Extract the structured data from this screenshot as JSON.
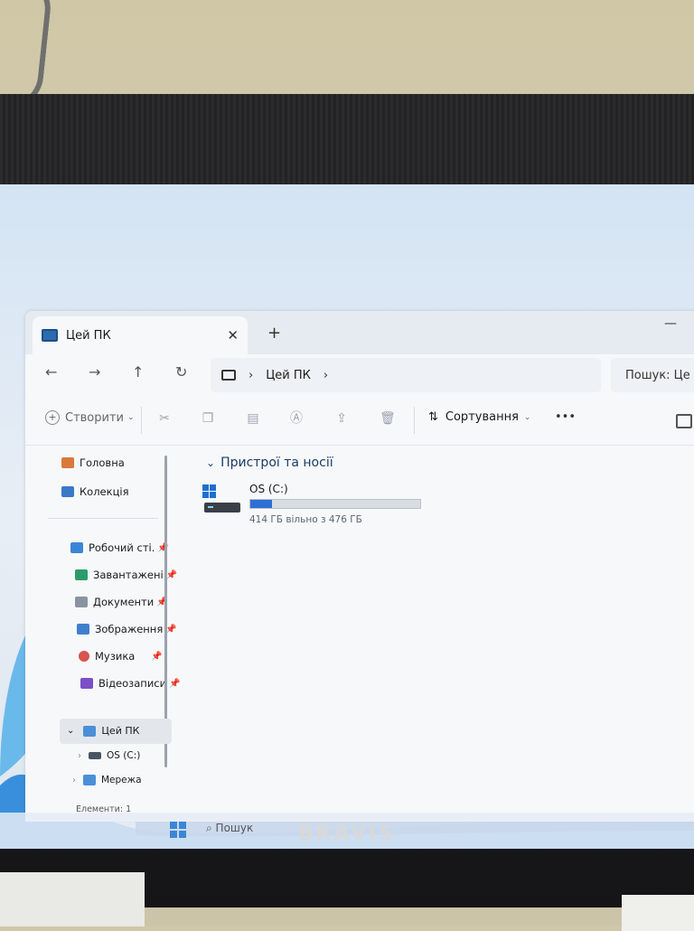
{
  "explorer": {
    "tab_title": "Цей ПК",
    "new_tab": "+",
    "minimize": "—",
    "nav": {
      "back": "←",
      "forward": "→",
      "up": "↑",
      "refresh": "↻"
    },
    "breadcrumb": [
      "Цей ПК"
    ],
    "search_placeholder": "Пошук: Це",
    "toolbar": {
      "create_label": "Створити",
      "sort_label": "Сортування",
      "more": "•••"
    },
    "sidebar": {
      "top_items": [
        {
          "label": "Головна",
          "icon": "home-icon"
        },
        {
          "label": "Колекція",
          "icon": "gallery-icon"
        }
      ],
      "pinned": [
        {
          "label": "Робочий сті.",
          "icon": "desktop-folder-icon"
        },
        {
          "label": "Завантажені",
          "icon": "download-icon"
        },
        {
          "label": "Документи",
          "icon": "documents-icon"
        },
        {
          "label": "Зображення",
          "icon": "pictures-icon"
        },
        {
          "label": "Музика",
          "icon": "music-icon"
        },
        {
          "label": "Відеозаписи",
          "icon": "videos-icon"
        }
      ],
      "this_pc": "Цей ПК",
      "drive": "OS (C:)",
      "network": "Мережа"
    },
    "status": "Елементи: 1",
    "section_title": "Пристрої та носії",
    "drive": {
      "label": "OS (C:)",
      "free_text": "414 ГБ вільно з 476 ГБ",
      "used_fraction": 0.13
    }
  },
  "taskbar": {
    "search_label": "Пошук"
  },
  "monitor_brand": "BRAVIS",
  "colors": {
    "accent": "#2e6fd6",
    "folder": "#2b6cb0"
  }
}
